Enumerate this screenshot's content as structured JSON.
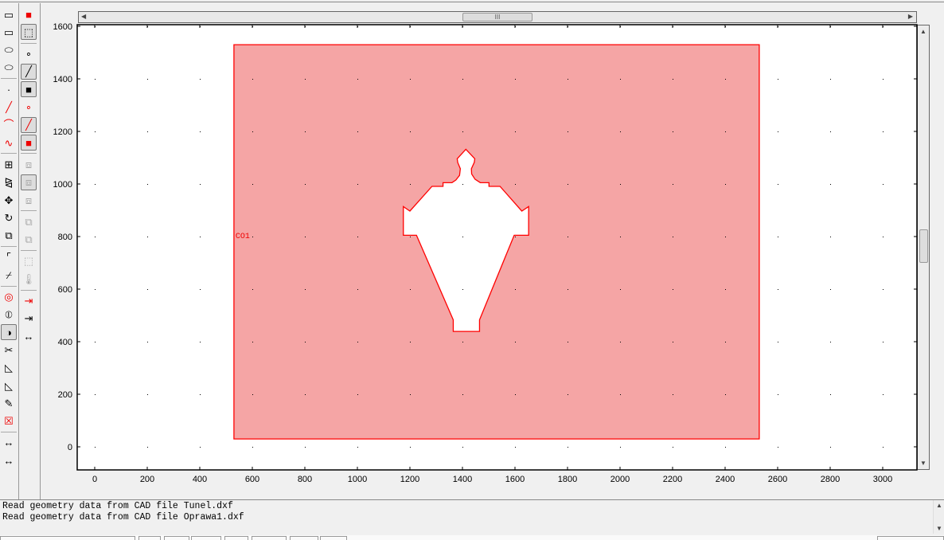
{
  "toolbar_left": [
    "rectangle-icon",
    "rectangle-center-icon",
    "ellipse-icon",
    "ellipse-center-icon",
    "sep",
    "point-icon",
    "line-icon",
    "arc-icon",
    "polyline-icon",
    "sep",
    "array-icon",
    "mirror-icon",
    "move-icon",
    "rotate-icon",
    "scale-icon",
    "sep",
    "fillet-icon",
    "chamfer-icon",
    "sep",
    "union-icon",
    "intersection-icon",
    "difference-icon",
    "split-icon",
    "coerce-solid-icon",
    "coerce-curve-icon",
    "edit-object-icon",
    "delete-icon",
    "sep",
    "dimension-icon",
    "dimension-alt-icon"
  ],
  "toolbar_right": [
    "draw-mode-icon",
    "select-mode-icon",
    "sep",
    "vertex-mode-icon",
    "edge-mode-icon",
    "subdomain-mode-icon",
    "point-select-icon",
    "edge-select-icon",
    "subdomain-select-icon",
    "sep",
    "zoom-extents-icon",
    "zoom-window-icon",
    "zoom-3d-icon",
    "sep",
    "select-all-icon",
    "select-none-icon",
    "sep",
    "properties-icon",
    "thermometer-icon",
    "sep",
    "import-icon",
    "export-icon",
    "measure-icon"
  ],
  "chart_data": {
    "type": "scatter",
    "xlim": [
      -70,
      3120
    ],
    "ylim": [
      -90,
      1620
    ],
    "x_ticks": [
      "0",
      "200",
      "400",
      "600",
      "800",
      "1000",
      "1200",
      "1400",
      "1600",
      "1800",
      "2000",
      "2200",
      "2400",
      "2600",
      "2800",
      "3000"
    ],
    "y_ticks": [
      "0",
      "200",
      "400",
      "600",
      "800",
      "1000",
      "1200",
      "1400",
      "1600"
    ],
    "grid": "dots",
    "objects": [
      {
        "name": "CO1",
        "label_at": [
          539,
          806
        ],
        "fill": "#f5a5a5",
        "stroke": "#ff0000",
        "outer": [
          [
            530,
            30
          ],
          [
            2530,
            30
          ],
          [
            2530,
            1530
          ],
          [
            530,
            1530
          ]
        ],
        "hole": [
          [
            1413,
            1132
          ],
          [
            1380,
            1096
          ],
          [
            1382,
            1082
          ],
          [
            1392,
            1058
          ],
          [
            1389,
            1033
          ],
          [
            1375,
            1015
          ],
          [
            1360,
            1005
          ],
          [
            1326,
            1005
          ],
          [
            1326,
            991
          ],
          [
            1284,
            991
          ],
          [
            1200,
            897
          ],
          [
            1175,
            914
          ],
          [
            1175,
            805
          ],
          [
            1225,
            805
          ],
          [
            1365,
            483
          ],
          [
            1365,
            439
          ],
          [
            1465,
            439
          ],
          [
            1465,
            483
          ],
          [
            1597,
            805
          ],
          [
            1652,
            805
          ],
          [
            1652,
            914
          ],
          [
            1626,
            897
          ],
          [
            1543,
            991
          ],
          [
            1501,
            991
          ],
          [
            1501,
            1005
          ],
          [
            1468,
            1005
          ],
          [
            1448,
            1018
          ],
          [
            1435,
            1038
          ],
          [
            1434,
            1058
          ],
          [
            1445,
            1082
          ],
          [
            1447,
            1096
          ]
        ]
      }
    ]
  },
  "scroll": {
    "thumb_grip": "III"
  },
  "output": [
    "Read geometry data from CAD file Tunel.dxf",
    "Read geometry data from CAD file Oprawa1.dxf"
  ]
}
